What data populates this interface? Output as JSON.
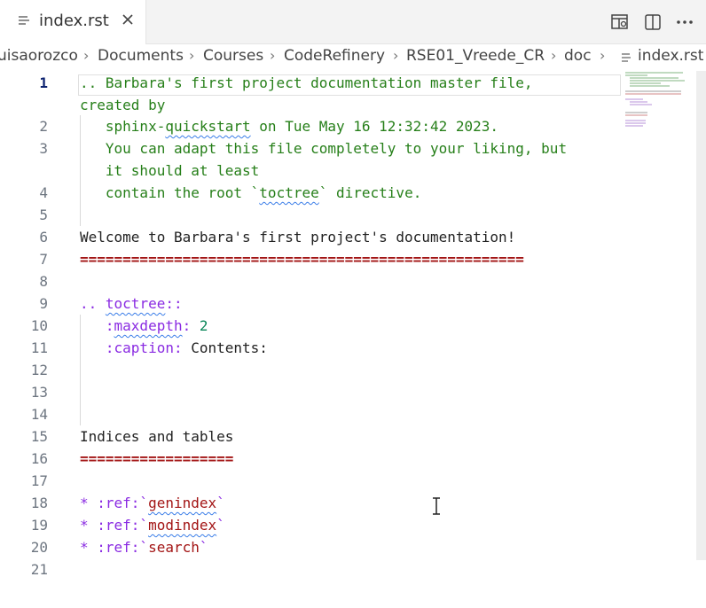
{
  "tab": {
    "title": "index.rst",
    "icon": "lines-file-icon"
  },
  "actions": [
    "open-preview-icon",
    "split-editor-icon",
    "more-actions-icon"
  ],
  "breadcrumb": {
    "items": [
      "uisaorozco",
      "Documents",
      "Courses",
      "CodeRefinery",
      "RSE01_Vreede_CR",
      "doc"
    ],
    "file": "index.rst"
  },
  "editor": {
    "active_line": "1",
    "lines": [
      {
        "num": "1",
        "parts": [
          ".. Barbara's first project documentation master file,"
        ]
      },
      {
        "num": "",
        "parts": [
          "created by"
        ]
      },
      {
        "num": "2",
        "parts": [
          "   sphinx-",
          "quickstart",
          " on Tue May 16 12:32:42 2023."
        ]
      },
      {
        "num": "3",
        "parts": [
          "   You can adapt this file completely to your liking, but"
        ]
      },
      {
        "num": "",
        "parts": [
          "   it should at least"
        ]
      },
      {
        "num": "4",
        "parts": [
          "   contain the root `",
          "toctree",
          "` directive."
        ]
      },
      {
        "num": "5",
        "parts": [
          ""
        ]
      },
      {
        "num": "6",
        "parts": [
          "Welcome to Barbara's first project's documentation!"
        ]
      },
      {
        "num": "7",
        "parts": [
          "===================================================="
        ]
      },
      {
        "num": "8",
        "parts": [
          ""
        ]
      },
      {
        "num": "9",
        "parts": [
          ".. ",
          "toctree",
          "::"
        ]
      },
      {
        "num": "10",
        "parts": [
          "   :",
          "maxdepth",
          ": ",
          "2"
        ]
      },
      {
        "num": "11",
        "parts": [
          "   :caption:",
          " Contents:"
        ]
      },
      {
        "num": "12",
        "parts": [
          ""
        ]
      },
      {
        "num": "13",
        "parts": [
          ""
        ]
      },
      {
        "num": "14",
        "parts": [
          ""
        ]
      },
      {
        "num": "15",
        "parts": [
          "Indices and tables"
        ]
      },
      {
        "num": "16",
        "parts": [
          "=================="
        ]
      },
      {
        "num": "17",
        "parts": [
          ""
        ]
      },
      {
        "num": "18",
        "parts": [
          "* :ref:`",
          "genindex",
          "`"
        ]
      },
      {
        "num": "19",
        "parts": [
          "* :ref:`",
          "modindex",
          "`"
        ]
      },
      {
        "num": "20",
        "parts": [
          "* :ref:`",
          "search",
          "`"
        ]
      },
      {
        "num": "21",
        "parts": [
          ""
        ]
      }
    ]
  }
}
